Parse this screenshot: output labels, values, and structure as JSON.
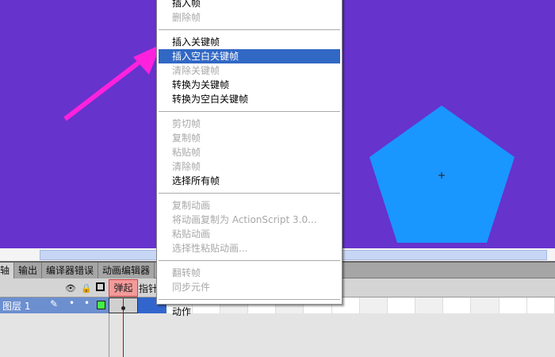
{
  "colors": {
    "stage": "#6633cc",
    "shape": "#1a96ff",
    "arrow": "#ff22dd",
    "highlight": "#3168c4"
  },
  "tabs": [
    "轴",
    "输出",
    "编译器错误",
    "动画编辑器"
  ],
  "timeline": {
    "frame_label": "弹起",
    "next_label": "指针",
    "layer_name": "图层 1"
  },
  "menu": {
    "groups": [
      [
        {
          "label": "插入帧",
          "enabled": true
        },
        {
          "label": "删除帧",
          "enabled": false
        }
      ],
      [
        {
          "label": "插入关键帧",
          "enabled": true
        },
        {
          "label": "插入空白关键帧",
          "enabled": true,
          "highlighted": true
        },
        {
          "label": "清除关键帧",
          "enabled": false
        },
        {
          "label": "转换为关键帧",
          "enabled": true
        },
        {
          "label": "转换为空白关键帧",
          "enabled": true
        }
      ],
      [
        {
          "label": "剪切帧",
          "enabled": false
        },
        {
          "label": "复制帧",
          "enabled": false
        },
        {
          "label": "粘贴帧",
          "enabled": false
        },
        {
          "label": "清除帧",
          "enabled": false
        },
        {
          "label": "选择所有帧",
          "enabled": true
        }
      ],
      [
        {
          "label": "复制动画",
          "enabled": false
        },
        {
          "label": "将动画复制为 ActionScript 3.0...",
          "enabled": false
        },
        {
          "label": "粘贴动画",
          "enabled": false
        },
        {
          "label": "选择性粘贴动画...",
          "enabled": false
        }
      ],
      [
        {
          "label": "翻转帧",
          "enabled": false
        },
        {
          "label": "同步元件",
          "enabled": false
        }
      ],
      [
        {
          "label": "动作",
          "enabled": true
        }
      ]
    ]
  }
}
